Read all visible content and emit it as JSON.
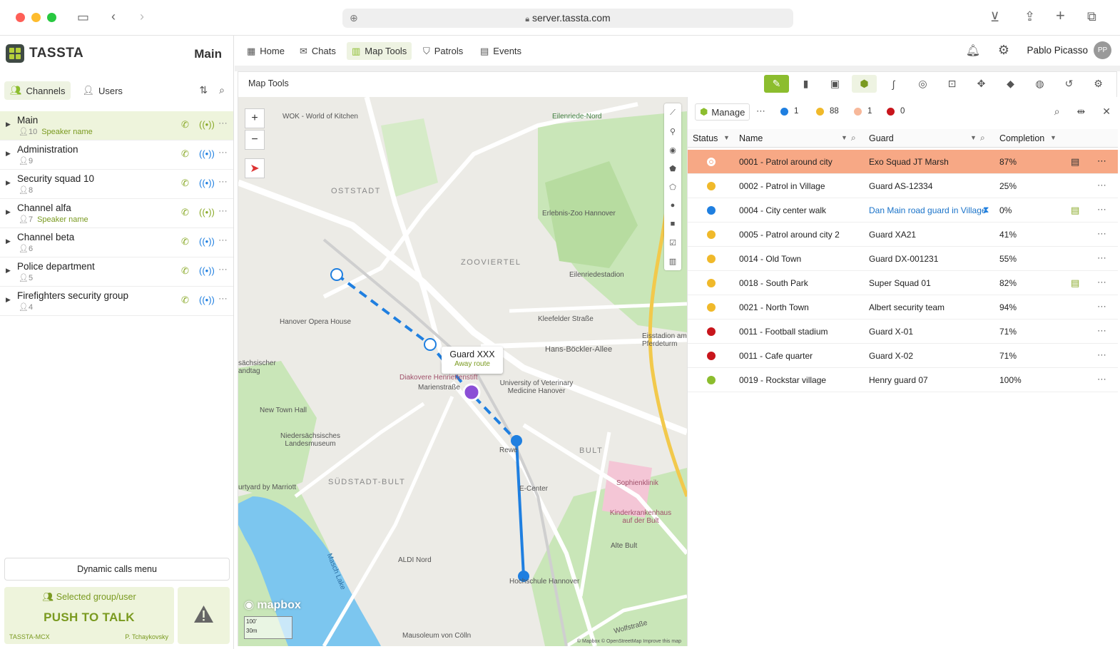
{
  "browser": {
    "url": "server.tassta.com"
  },
  "app": {
    "name": "TASSTA",
    "channel_title": "Main"
  },
  "left_tabs": [
    {
      "label": "Channels"
    },
    {
      "label": "Users"
    }
  ],
  "channels": [
    {
      "name": "Main",
      "count": "10",
      "speaker": "Speaker name"
    },
    {
      "name": "Administration",
      "count": "9",
      "speaker": ""
    },
    {
      "name": "Security squad 10",
      "count": "8",
      "speaker": ""
    },
    {
      "name": "Channel alfa",
      "count": "7",
      "speaker": "Speaker name"
    },
    {
      "name": "Channel beta",
      "count": "6",
      "speaker": ""
    },
    {
      "name": "Police department",
      "count": "5",
      "speaker": ""
    },
    {
      "name": "Firefighters security group",
      "count": "4",
      "speaker": ""
    }
  ],
  "bottom": {
    "dynamic_calls": "Dynamic calls menu",
    "selected": "Selected group/user",
    "ptt": "PUSH TO TALK",
    "left_label": "TASSTA-MCX",
    "right_label": "P. Tchaykovsky"
  },
  "nav": [
    {
      "label": "Home"
    },
    {
      "label": "Chats"
    },
    {
      "label": "Map Tools"
    },
    {
      "label": "Patrols"
    },
    {
      "label": "Events"
    }
  ],
  "user": {
    "name": "Pablo Picasso",
    "initials": "PP"
  },
  "panel": {
    "title": "Map Tools"
  },
  "map": {
    "popup_title": "Guard XXX",
    "popup_sub": "Away route",
    "labels": {
      "wok": "WOK - World of Kitchen",
      "oststadt": "OSTSTADT",
      "eilenriede": "Eilenriede-Nord",
      "zoo": "Erlebnis-Zoo Hannover",
      "zooviertel": "ZOOVIERTEL",
      "stadion": "Eilenriedestadion",
      "opera": "Hanover Opera House",
      "klee": "Kleefelder Straße",
      "hans": "Hans-Böckler-Allee",
      "diakovere": "Diakovere Henriettenstift",
      "marien": "Marienstraße",
      "univ": "University of Veterinary Medicine Hanover",
      "newtown": "New Town Hall",
      "nieder": "Niedersächsisches Landesmuseum",
      "suedstadt": "SÜDSTADT-BULT",
      "bult": "BULT",
      "sophien": "Sophienklinik",
      "kinder": "Kinderkrankenhaus auf der Bult",
      "altebult": "Alte Bult",
      "ecenter": "E-Center",
      "aldi": "ALDI Nord",
      "hochschule": "Hochschule Hannover",
      "mausoleum": "Mausoleum von Cölln",
      "maschlake": "Masch Lake",
      "marriott": "urtyard by Marriott",
      "eisstadion": "Eisstadion am Pferdeturm",
      "wolf": "Wolfstraße",
      "rewe": "Rewe",
      "saxon": "sächsischer andtag"
    },
    "brand": "mapbox",
    "scale1": "100'",
    "scale2": "30m",
    "attribution": "© Mapbox © OpenStreetMap Improve this map"
  },
  "patrols": {
    "manage": "Manage",
    "counts": [
      {
        "value": "1",
        "color": "#1f7fe0"
      },
      {
        "value": "88",
        "color": "#f0b92a"
      },
      {
        "value": "1",
        "color": "#f7b89a"
      },
      {
        "value": "0",
        "color": "#c8151c"
      }
    ],
    "columns": {
      "status": "Status",
      "name": "Name",
      "guard": "Guard",
      "completion": "Completion"
    },
    "rows": [
      {
        "name": "0001 - Patrol around city",
        "guard": "Exo Squad JT Marsh",
        "completion": "87%",
        "color": "#ffffff"
      },
      {
        "name": "0002 - Patrol in Village",
        "guard": "Guard AS-12334",
        "completion": "25%",
        "color": "#f0b92a"
      },
      {
        "name": "0004 - City center walk",
        "guard": "Dan Main road guard in Village",
        "completion": "0%",
        "color": "#1f7fe0"
      },
      {
        "name": "0005 - Patrol around city 2",
        "guard": "Guard XA21",
        "completion": "41%",
        "color": "#f0b92a"
      },
      {
        "name": "0014 - Old Town",
        "guard": "Guard DX-001231",
        "completion": "55%",
        "color": "#f0b92a"
      },
      {
        "name": "0018 - South Park",
        "guard": "Super Squad 01",
        "completion": "82%",
        "color": "#f0b92a"
      },
      {
        "name": "0021 - North Town",
        "guard": "Albert security team",
        "completion": "94%",
        "color": "#f0b92a"
      },
      {
        "name": "0011 - Football stadium",
        "guard": "Guard X-01",
        "completion": "71%",
        "color": "#c8151c"
      },
      {
        "name": "0011 - Cafe quarter",
        "guard": "Guard X-02",
        "completion": "71%",
        "color": "#c8151c"
      },
      {
        "name": "0019 - Rockstar village",
        "guard": "Henry guard 07",
        "completion": "100%",
        "color": "#8cbd2e"
      }
    ]
  }
}
